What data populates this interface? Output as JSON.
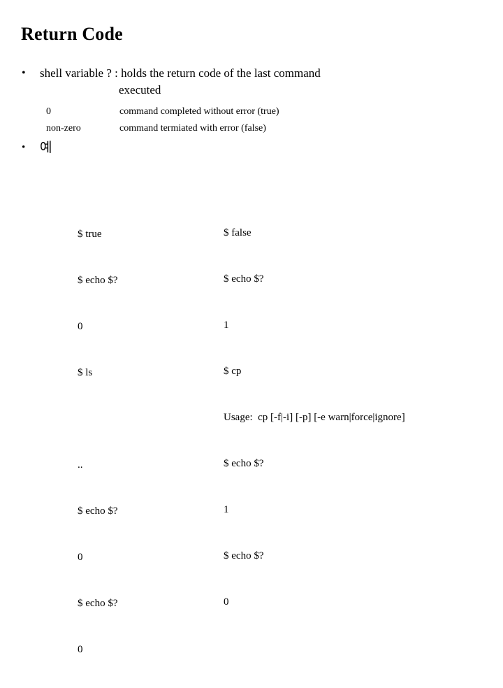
{
  "slide": {
    "title": "Return Code",
    "background_color": "#ffffff",
    "text_color": "#000000"
  },
  "bullets": [
    {
      "marker": "•",
      "text": "shell variable ? : holds the return code of the last command",
      "continuation": "executed"
    },
    {
      "marker": "•",
      "text": "예"
    }
  ],
  "definitions": [
    {
      "key": "0",
      "value": "command completed without error (true)"
    },
    {
      "key": "non-zero",
      "value": "command termiated with error (false)"
    }
  ],
  "terminal_left": {
    "lines": [
      "$ true",
      "$ echo $?",
      "0",
      "$ ls",
      "",
      "..",
      "$ echo $?",
      "0",
      "$ echo $?",
      "0"
    ]
  },
  "terminal_right": {
    "lines": [
      "$ false",
      "$ echo $?",
      "1",
      "$ cp",
      "Usage:  cp [-f|-i] [-p] [-e warn|force|ignore]",
      "$ echo $?",
      "1",
      "$ echo $?",
      "0"
    ]
  }
}
